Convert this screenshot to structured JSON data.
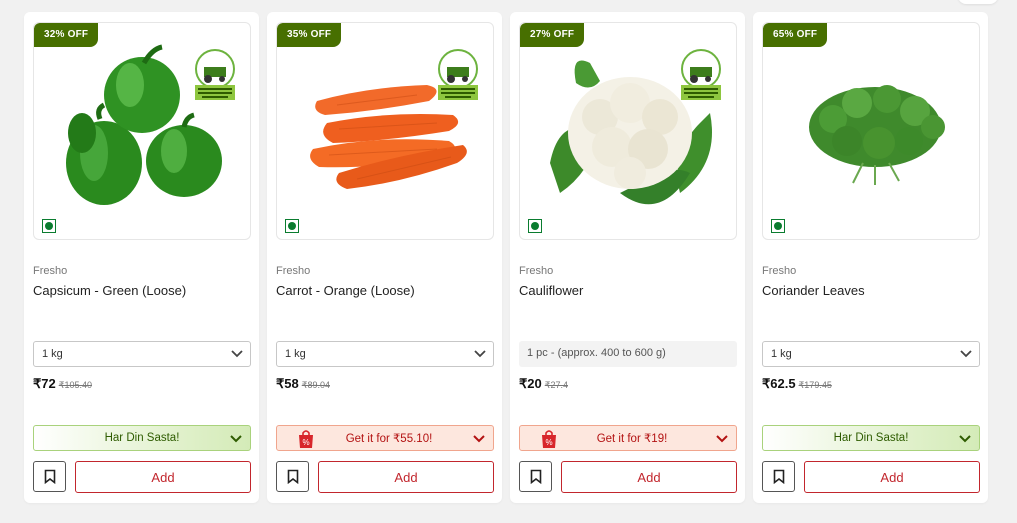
{
  "products": [
    {
      "discount": "32% OFF",
      "brand": "Fresho",
      "name": "Capsicum - Green (Loose)",
      "quantity": "1 kg",
      "price": "₹72",
      "mrp": "₹105.40",
      "offer": "Har Din Sasta!",
      "add": "Add",
      "partner_logo_text": "bigbasket Partnering with Indian Farmers"
    },
    {
      "discount": "35% OFF",
      "brand": "Fresho",
      "name": "Carrot - Orange (Loose)",
      "quantity": "1 kg",
      "price": "₹58",
      "mrp": "₹89.04",
      "offer": "Get it for ₹55.10!",
      "add": "Add",
      "partner_logo_text": "bigbasket Partnering with Indian Farmers"
    },
    {
      "discount": "27% OFF",
      "brand": "Fresho",
      "name": "Cauliflower",
      "quantity": "1 pc - (approx. 400 to 600 g)",
      "price": "₹20",
      "mrp": "₹27.4",
      "offer": "Get it for ₹19!",
      "add": "Add",
      "partner_logo_text": "bigbasket Partnering with Indian Farmers"
    },
    {
      "discount": "65% OFF",
      "brand": "Fresho",
      "name": "Coriander Leaves",
      "quantity": "1 kg",
      "price": "₹62.5",
      "mrp": "₹179.45",
      "offer": "Har Din Sasta!",
      "add": "Add"
    }
  ],
  "colors": {
    "badge": "#476f00",
    "add_red": "#c2262d",
    "veg_green": "#0a7c2f"
  },
  "icons": {
    "veg": "veg-mark-icon",
    "bookmark": "bookmark-icon",
    "chevron": "chevron-down-icon",
    "bag": "shopping-bag-icon"
  }
}
